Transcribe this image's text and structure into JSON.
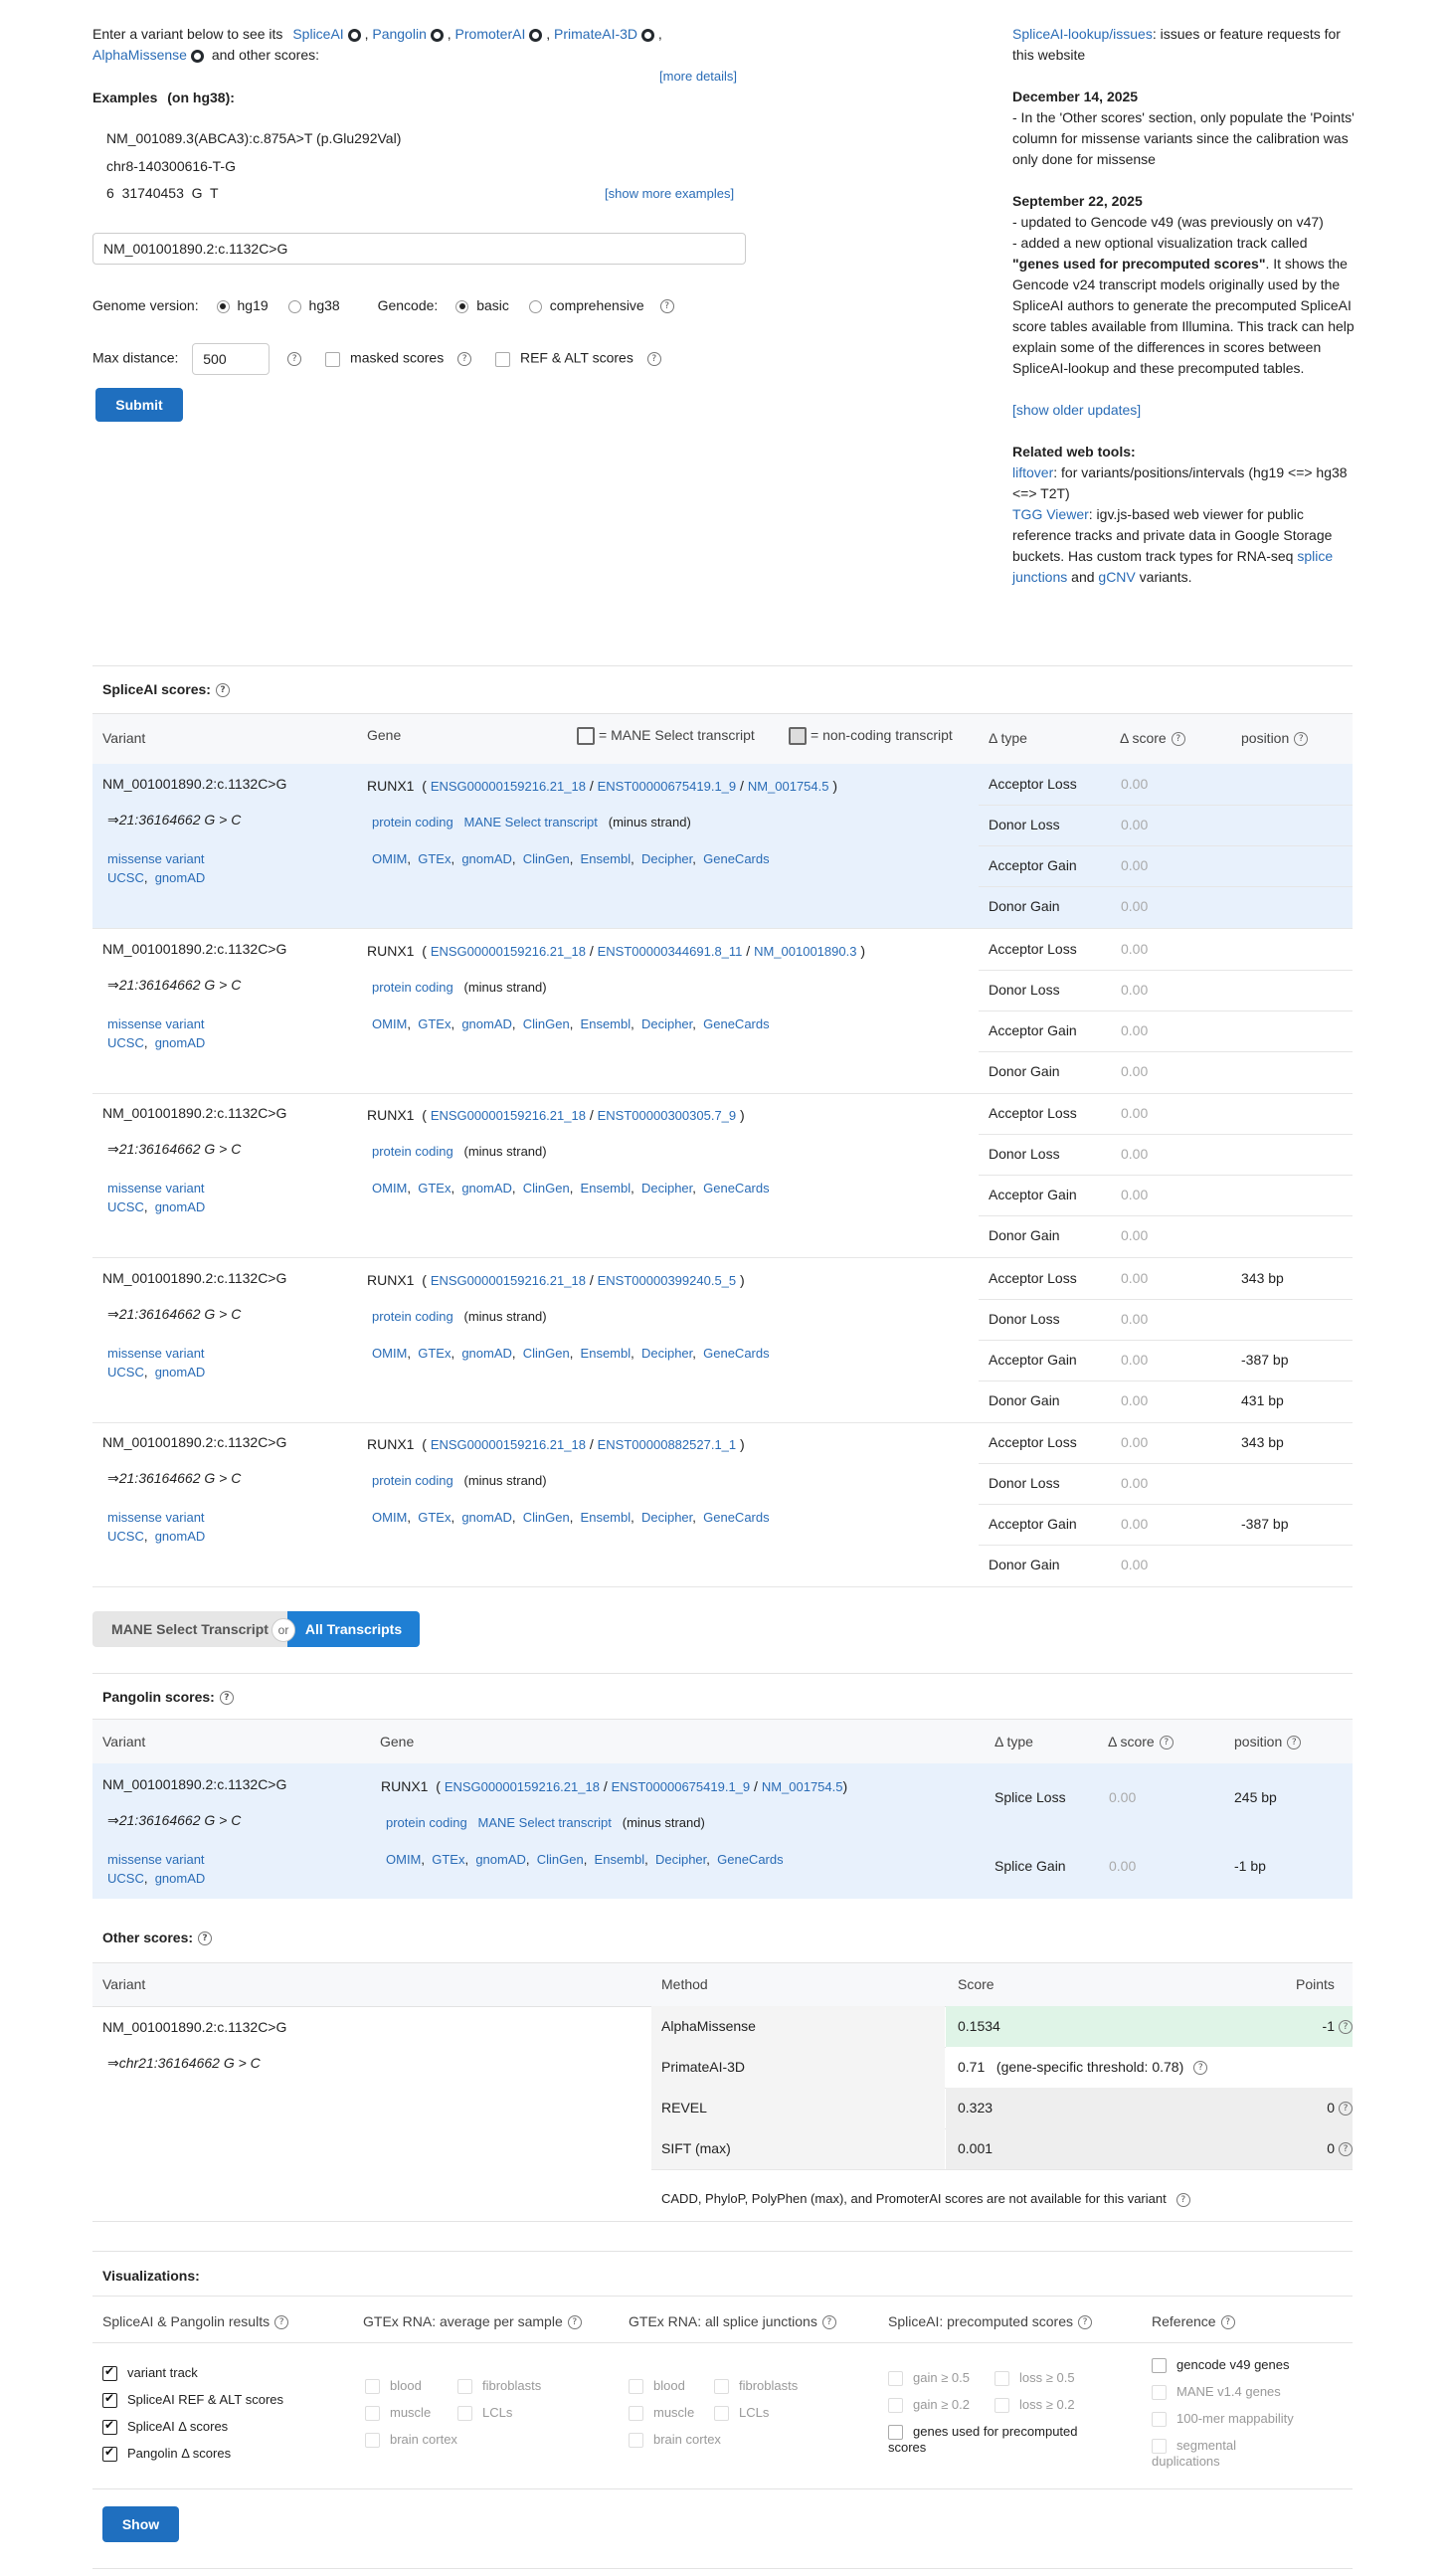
{
  "intro": {
    "prefix": "Enter a variant below to see its",
    "tools": [
      "SpliceAI",
      "Pangolin",
      "PromoterAI",
      "PrimateAI-3D"
    ],
    "tool5": "AlphaMissense",
    "suffix": "and other scores:",
    "more_details": "[more details]"
  },
  "examples": {
    "title": "Examples",
    "subtitle": "(on hg38):",
    "ex1": "NM_001089.3(ABCA3):c.875A>T (p.Glu292Val)",
    "ex2": "chr8-140300616-T-G",
    "ex3": "6  31740453  G  T",
    "show_more": "[show more examples]"
  },
  "variant_input": "NM_001001890.2:c.1132C>G",
  "genome": {
    "label": "Genome version:",
    "opt1": "hg19",
    "opt2": "hg38",
    "selected": "hg19"
  },
  "gencode": {
    "label": "Gencode:",
    "opt1": "basic",
    "opt2": "comprehensive",
    "selected": "basic"
  },
  "maxdist": {
    "label": "Max distance:",
    "value": "500",
    "masked": "masked scores",
    "refalt": "REF & ALT scores"
  },
  "submit_label": "Submit",
  "sidebar": {
    "issues_link": "SpliceAI-lookup/issues",
    "issues_text": ": issues or feature requests for this website",
    "date1": "December 14, 2025",
    "news1": "- In the 'Other scores' section, only populate the 'Points' column for missense variants since the calibration was only done for missense",
    "date2": "September 22, 2025",
    "news2a": "- updated to Gencode v49 (was previously on v47)",
    "news2b_pre": "- added a new optional visualization track called ",
    "news2b_bold": "\"genes used for precomputed scores\"",
    "news2b_post": ". It shows the Gencode v24 transcript models originally used by the SpliceAI authors to generate the precomputed SpliceAI score tables available from Illumina. This track can help explain some of the differences in scores between SpliceAI-lookup and these precomputed tables.",
    "older": "[show older updates]",
    "related_title": "Related web tools:",
    "liftover": "liftover",
    "liftover_text": ": for variants/positions/intervals (hg19 <=> hg38 <=> T2T)",
    "tgg": "TGG Viewer",
    "tgg_text": ": igv.js-based web viewer for public reference tracks and private data in Google Storage buckets. Has custom track types for RNA-seq ",
    "splice_junctions": "splice junctions",
    "and": " and ",
    "gcnv": "gCNV",
    "variants": " variants."
  },
  "spliceai": {
    "title": "SpliceAI scores:",
    "headers": {
      "variant": "Variant",
      "gene": "Gene",
      "mane_legend": "= MANE Select transcript",
      "nc_legend": "= non-coding transcript",
      "dtype": "Δ type",
      "dscore": "Δ score",
      "position": "position"
    },
    "rows": [
      {
        "variant": "NM_001001890.2:c.1132C>G",
        "coord": "⇒21:36164662 G > C",
        "consequence": "missense variant",
        "gene": "RUNX1",
        "ensg": "ENSG00000159216.21_18",
        "enst": "ENST00000675419.1_9",
        "refseq": "NM_001754.5",
        "biotype": "protein coding",
        "mane": "MANE Select transcript",
        "strand": "(minus strand)",
        "deltas": [
          [
            "Acceptor Loss",
            "0.00",
            ""
          ],
          [
            "Donor Loss",
            "0.00",
            ""
          ],
          [
            "Acceptor Gain",
            "0.00",
            ""
          ],
          [
            "Donor Gain",
            "0.00",
            ""
          ]
        ]
      },
      {
        "variant": "NM_001001890.2:c.1132C>G",
        "coord": "⇒21:36164662 G > C",
        "consequence": "missense variant",
        "gene": "RUNX1",
        "ensg": "ENSG00000159216.21_18",
        "enst": "ENST00000344691.8_11",
        "refseq": "NM_001001890.3",
        "biotype": "protein coding",
        "mane": "",
        "strand": "(minus strand)",
        "deltas": [
          [
            "Acceptor Loss",
            "0.00",
            ""
          ],
          [
            "Donor Loss",
            "0.00",
            ""
          ],
          [
            "Acceptor Gain",
            "0.00",
            ""
          ],
          [
            "Donor Gain",
            "0.00",
            ""
          ]
        ]
      },
      {
        "variant": "NM_001001890.2:c.1132C>G",
        "coord": "⇒21:36164662 G > C",
        "consequence": "missense variant",
        "gene": "RUNX1",
        "ensg": "ENSG00000159216.21_18",
        "enst": "ENST00000300305.7_9",
        "refseq": "",
        "biotype": "protein coding",
        "mane": "",
        "strand": "(minus strand)",
        "deltas": [
          [
            "Acceptor Loss",
            "0.00",
            ""
          ],
          [
            "Donor Loss",
            "0.00",
            ""
          ],
          [
            "Acceptor Gain",
            "0.00",
            ""
          ],
          [
            "Donor Gain",
            "0.00",
            ""
          ]
        ]
      },
      {
        "variant": "NM_001001890.2:c.1132C>G",
        "coord": "⇒21:36164662 G > C",
        "consequence": "missense variant",
        "gene": "RUNX1",
        "ensg": "ENSG00000159216.21_18",
        "enst": "ENST00000399240.5_5",
        "refseq": "",
        "biotype": "protein coding",
        "mane": "",
        "strand": "(minus strand)",
        "deltas": [
          [
            "Acceptor Loss",
            "0.00",
            "343 bp"
          ],
          [
            "Donor Loss",
            "0.00",
            ""
          ],
          [
            "Acceptor Gain",
            "0.00",
            "-387 bp"
          ],
          [
            "Donor Gain",
            "0.00",
            "431 bp"
          ]
        ]
      },
      {
        "variant": "NM_001001890.2:c.1132C>G",
        "coord": "⇒21:36164662 G > C",
        "consequence": "missense variant",
        "gene": "RUNX1",
        "ensg": "ENSG00000159216.21_18",
        "enst": "ENST00000882527.1_1",
        "refseq": "",
        "biotype": "protein coding",
        "mane": "",
        "strand": "(minus strand)",
        "deltas": [
          [
            "Acceptor Loss",
            "0.00",
            "343 bp"
          ],
          [
            "Donor Loss",
            "0.00",
            ""
          ],
          [
            "Acceptor Gain",
            "0.00",
            "-387 bp"
          ],
          [
            "Donor Gain",
            "0.00",
            ""
          ]
        ]
      }
    ],
    "toggle": {
      "mane": "MANE Select Transcript",
      "or": "or",
      "all": "All Transcripts"
    }
  },
  "db_links": [
    "OMIM",
    "GTEx",
    "gnomAD",
    "ClinGen",
    "Ensembl",
    "Decipher",
    "GeneCards"
  ],
  "var_links": [
    "UCSC",
    "gnomAD"
  ],
  "pangolin": {
    "title": "Pangolin scores:",
    "headers": {
      "variant": "Variant",
      "gene": "Gene",
      "dtype": "Δ type",
      "dscore": "Δ score",
      "position": "position"
    },
    "row": {
      "variant": "NM_001001890.2:c.1132C>G",
      "coord": "⇒21:36164662 G > C",
      "consequence": "missense variant",
      "gene": "RUNX1",
      "ensg": "ENSG00000159216.21_18",
      "enst": "ENST00000675419.1_9",
      "refseq": "NM_001754.5",
      "biotype": "protein coding",
      "mane": "MANE Select transcript",
      "strand": "(minus strand)",
      "deltas": [
        [
          "Splice Loss",
          "0.00",
          "245 bp"
        ],
        [
          "Splice Gain",
          "0.00",
          "-1 bp"
        ]
      ]
    }
  },
  "other": {
    "title": "Other scores:",
    "headers": {
      "variant": "Variant",
      "method": "Method",
      "score": "Score",
      "points": "Points"
    },
    "variant": "NM_001001890.2:c.1132C>G",
    "coord": "⇒chr21:36164662 G > C",
    "rows": [
      {
        "method": "AlphaMissense",
        "score": "0.1534",
        "points": "-1",
        "bg": "#dff4e7"
      },
      {
        "method": "PrimateAI-3D",
        "score": "0.71",
        "extra": "(gene-specific threshold: 0.78)",
        "points": "",
        "bg": "#ffffff"
      },
      {
        "method": "REVEL",
        "score": "0.323",
        "points": "0",
        "bg": "#eeeeee"
      },
      {
        "method": "SIFT (max)",
        "score": "0.001",
        "points": "0",
        "bg": "#eeeeee"
      }
    ],
    "na_text": "CADD,  PhyloP,  PolyPhen (max),  and PromoterAI scores are not available for this variant"
  },
  "viz": {
    "title": "Visualizations:",
    "col1": {
      "title": "SpliceAI & Pangolin results",
      "items": [
        "variant track",
        "SpliceAI REF & ALT scores",
        "SpliceAI Δ scores",
        "Pangolin Δ  scores"
      ]
    },
    "col2": {
      "title": "GTEx RNA: average per sample",
      "items": [
        "blood",
        "fibroblasts",
        "muscle",
        "LCLs",
        "brain cortex"
      ]
    },
    "col3": {
      "title": "GTEx RNA: all splice junctions",
      "items": [
        "blood",
        "fibroblasts",
        "muscle",
        "LCLs",
        "brain cortex"
      ]
    },
    "col4": {
      "title": "SpliceAI: precomputed scores",
      "items": [
        "gain ≥ 0.5",
        "loss ≥ 0.5",
        "gain ≥ 0.2",
        "loss ≥ 0.2",
        "genes used for precomputed scores"
      ]
    },
    "col5": {
      "title": "Reference",
      "items": [
        "gencode v49 genes",
        "MANE v1.4 genes",
        "100-mer mappability",
        "segmental duplications"
      ]
    },
    "show_label": "Show"
  },
  "colors": {
    "link": "#2a6cb6",
    "button": "#1f6fbf",
    "highlight_row": "#e8f1fc",
    "alphamissense_bg": "#dff4e7"
  }
}
